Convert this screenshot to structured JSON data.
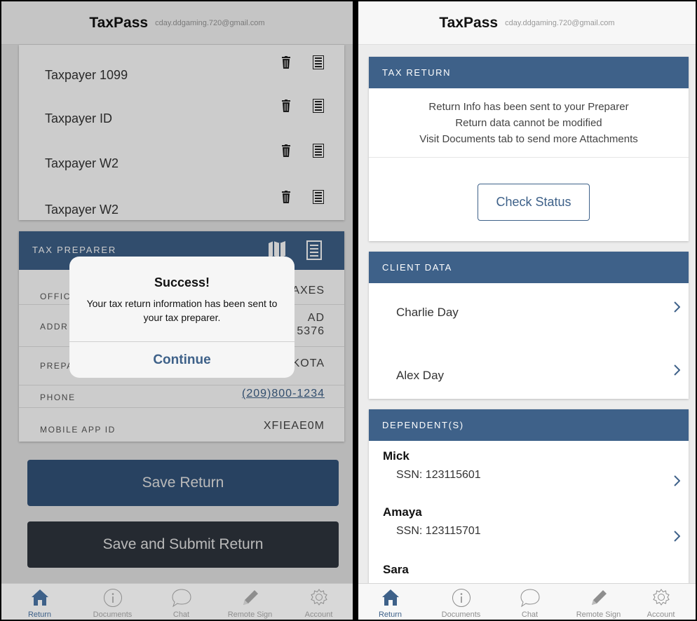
{
  "app": {
    "name": "TaxPass",
    "email": "cday.ddgaming.720@gmail.com"
  },
  "left": {
    "documents": [
      {
        "label": "Taxpayer 1099"
      },
      {
        "label": "Taxpayer ID"
      },
      {
        "label": "Taxpayer W2"
      },
      {
        "label": "Taxpayer W2"
      }
    ],
    "preparer": {
      "title": "TAX PREPARER",
      "office_label": "OFFIC",
      "office_value": "AXES",
      "address_label": "ADDR",
      "address_line1": "AD",
      "address_line2": "5376",
      "preparer_label": "PREPA",
      "preparer_value": "KOTA",
      "phone_label": "PHONE",
      "phone_value": "(209)800-1234",
      "mobile_label": "MOBILE APP ID",
      "mobile_value": "XFIEAE0M"
    },
    "save_return": "Save Return",
    "save_submit": "Save and Submit Return",
    "alert": {
      "title": "Success!",
      "message": "Your tax return information has been sent to your tax preparer.",
      "button": "Continue"
    }
  },
  "right": {
    "tax_return": {
      "title": "TAX RETURN",
      "lines": [
        "Return Info has been sent to your Preparer",
        "Return data cannot be modified",
        "Visit Documents tab to send more Attachments"
      ],
      "check_status": "Check Status"
    },
    "client_data": {
      "title": "CLIENT DATA",
      "clients": [
        {
          "name": "Charlie Day"
        },
        {
          "name": "Alex Day"
        }
      ]
    },
    "dependents": {
      "title": "DEPENDENT(S)",
      "items": [
        {
          "name": "Mick",
          "ssn": "SSN: 123115601"
        },
        {
          "name": "Amaya",
          "ssn": "SSN: 123115701"
        },
        {
          "name": "Sara",
          "ssn": ""
        }
      ]
    }
  },
  "tabs": [
    {
      "label": "Return",
      "icon": "home-icon"
    },
    {
      "label": "Documents",
      "icon": "info-icon"
    },
    {
      "label": "Chat",
      "icon": "chat-icon"
    },
    {
      "label": "Remote Sign",
      "icon": "pencil-icon"
    },
    {
      "label": "Account",
      "icon": "gear-icon"
    }
  ],
  "colors": {
    "accent": "#3e6189",
    "dark_button": "#2f353e",
    "inactive_tab": "#8e8e8e"
  }
}
